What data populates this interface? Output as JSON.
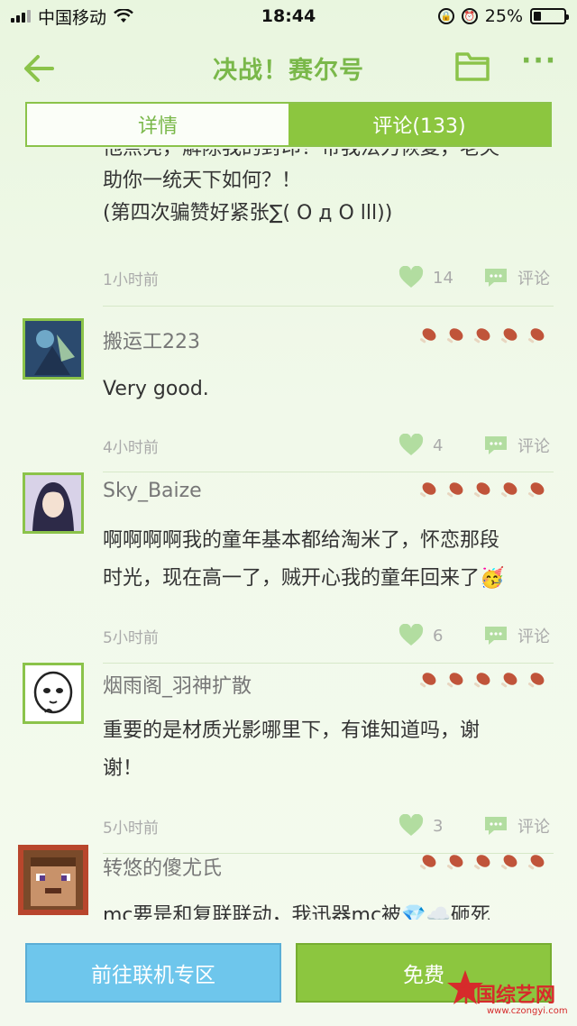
{
  "status_bar": {
    "carrier": "中国移动",
    "time": "18:44",
    "battery_pct": "25%",
    "battery_level": 0.25
  },
  "header": {
    "title": "决战！赛尔号",
    "back_icon": "back-arrow-icon",
    "folder_icon": "folder-icon",
    "more_icon": "more-dots-icon",
    "more_text": "···"
  },
  "tabs": [
    {
      "label": "详情",
      "active": false
    },
    {
      "label": "评论(133)",
      "active": true
    }
  ],
  "comments": [
    {
      "username": "",
      "lines": [
        "他点亮，解除我的封印！带我法力恢复，老夫",
        "助你一统天下如何？！",
        "(第四次骗赞好紧张∑( O д O lll))"
      ],
      "time": "1小时前",
      "likes": "14",
      "reply_label": "评论"
    },
    {
      "username": "搬运工223",
      "rating": 5,
      "lines": [
        "Very good."
      ],
      "time": "4小时前",
      "likes": "4",
      "reply_label": "评论"
    },
    {
      "username": "Sky_Baize",
      "rating": 5,
      "lines": [
        "啊啊啊啊我的童年基本都给淘米了，怀恋那段",
        "时光，现在高一了，贼开心我的童年回来了🥳"
      ],
      "time": "5小时前",
      "likes": "6",
      "reply_label": "评论"
    },
    {
      "username": "烟雨阁_羽神扩散",
      "rating": 5,
      "lines": [
        "重要的是材质光影哪里下，有谁知道吗，谢",
        "谢！"
      ],
      "time": "5小时前",
      "likes": "3",
      "reply_label": "评论"
    },
    {
      "username": "转悠的傻尤氏",
      "rating": 5,
      "lines": [
        "mc要是和复联联动，我迅器mc被💎☁️砸死"
      ],
      "time": "",
      "likes": "",
      "reply_label": ""
    }
  ],
  "bottom": {
    "left_button": "前往联机专区",
    "right_button": "免费"
  },
  "watermark": {
    "text": "中国综艺网",
    "url": "www.czongyi.com"
  },
  "colors": {
    "accent": "#8cc63f",
    "title": "#7ab84a",
    "blue_button": "#6ec6ec"
  }
}
